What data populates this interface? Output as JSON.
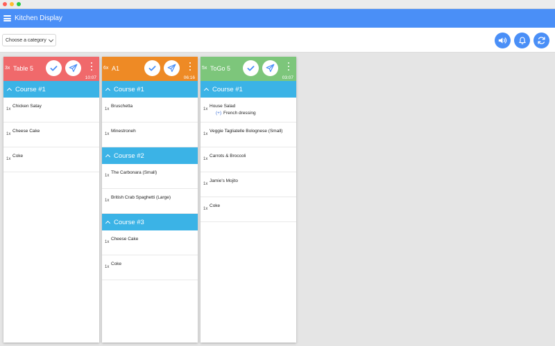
{
  "app": {
    "title": "Kitchen Display"
  },
  "toolbar": {
    "category_placeholder": "Choose a category"
  },
  "colors": {
    "primary": "#4a8ff7",
    "course": "#3bb3e6",
    "ticket_red": "#f0696b",
    "ticket_orange": "#ee8a25",
    "ticket_green": "#7dc67b"
  },
  "tickets": [
    {
      "count": "3x",
      "name": "Table 5",
      "time": "10:07",
      "color": "#f0696b",
      "courses": [
        {
          "label": "Course #1",
          "items": [
            {
              "qty": "1x",
              "name": "Chicken Satay"
            },
            {
              "qty": "1x",
              "name": "Cheese Cake"
            },
            {
              "qty": "1x",
              "name": "Coke"
            }
          ]
        }
      ]
    },
    {
      "count": "6x",
      "name": "A1",
      "time": "06:16",
      "color": "#ee8a25",
      "courses": [
        {
          "label": "Course #1",
          "items": [
            {
              "qty": "1x",
              "name": "Bruschetta"
            },
            {
              "qty": "1x",
              "name": "Minestroneh"
            }
          ]
        },
        {
          "label": "Course #2",
          "items": [
            {
              "qty": "1x",
              "name": "The Carbonara (Small)"
            },
            {
              "qty": "1x",
              "name": "British Crab Spaghetti (Large)"
            }
          ]
        },
        {
          "label": "Course #3",
          "items": [
            {
              "qty": "1x",
              "name": "Cheese Cake"
            },
            {
              "qty": "1x",
              "name": "Coke"
            }
          ]
        }
      ]
    },
    {
      "count": "5x",
      "name": "ToGo 5",
      "time": "03:07",
      "color": "#7dc67b",
      "courses": [
        {
          "label": "Course #1",
          "items": [
            {
              "qty": "1x",
              "name": "House Salad",
              "modifier_symbol": "(+)",
              "modifier": "French dressing"
            },
            {
              "qty": "1x",
              "name": "Veggie Tagliatelle Bolognese (Small)"
            },
            {
              "qty": "1x",
              "name": "Carrots & Broccoli"
            },
            {
              "qty": "1x",
              "name": "Jamie's Mojito"
            },
            {
              "qty": "1x",
              "name": "Coke"
            }
          ]
        }
      ]
    }
  ]
}
